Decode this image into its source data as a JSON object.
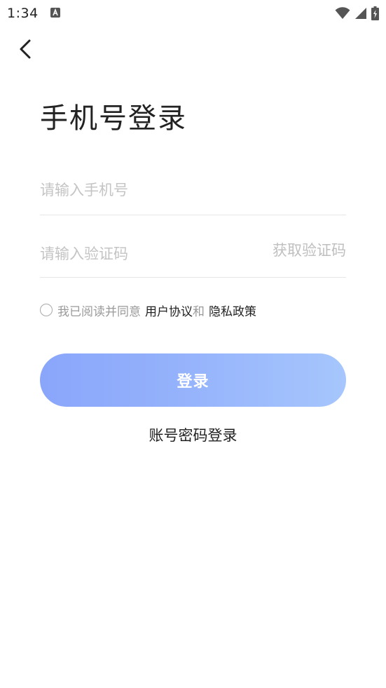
{
  "status_bar": {
    "time": "1:34",
    "notification_icon": "a-notification-icon",
    "icons": [
      "wifi-icon",
      "signal-icon",
      "battery-charging-icon"
    ]
  },
  "nav": {
    "back_icon": "chevron-left-icon"
  },
  "title": "手机号登录",
  "phone_field": {
    "placeholder": "请输入手机号",
    "value": ""
  },
  "code_field": {
    "placeholder": "请输入验证码",
    "value": "",
    "get_code_label": "获取验证码"
  },
  "agreement": {
    "checked": false,
    "prefix": "我已阅读并同意",
    "user_agreement": "用户协议",
    "and": "和",
    "privacy_policy": "隐私政策"
  },
  "login_button": {
    "label": "登录"
  },
  "password_login_label": "账号密码登录",
  "colors": {
    "button_gradient_start": "#8aa6fb",
    "button_gradient_end": "#a6c6fd",
    "placeholder": "#c4c4c4",
    "text": "#222222"
  }
}
